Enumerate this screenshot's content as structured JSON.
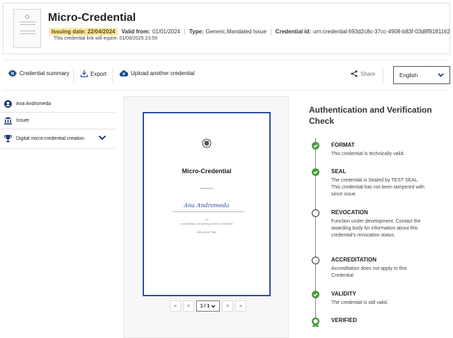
{
  "header": {
    "title": "Micro-Credential",
    "issuing_date": "Issuing date: 22/04/2024",
    "valid_from_label": "Valid from:",
    "valid_from": "01/01/2024",
    "type_label": "Type:",
    "type": "Generic,Mandated Issue",
    "credential_id_label": "Credential id:",
    "credential_id": "urn:credential:693d2c8c-37cc-4908-b83f-03d8f9181162",
    "expire": "This credential link will expire: 01/09/2025 23:59"
  },
  "toolbar": {
    "summary": "Credential summary",
    "export": "Export",
    "upload": "Upload another credential",
    "share": "Share",
    "language": "English"
  },
  "sidebar": {
    "items": [
      {
        "label": "Ana Andromeda",
        "icon": "user-icon"
      },
      {
        "label": "Issuer",
        "icon": "institution-icon"
      },
      {
        "label": "Digital micro-credential creation",
        "icon": "trophy-icon"
      }
    ]
  },
  "preview": {
    "doc_title": "Micro-Credential",
    "awarded_to": "awarded to",
    "name": "Ana Andromeda",
    "for": "for",
    "completing": "successfully completing a micro-credential",
    "grade": "with grade Pass",
    "pager": {
      "first": "«",
      "prev": "<",
      "page": "1 / 1",
      "next": ">",
      "last": "»"
    }
  },
  "verification": {
    "title": "Authentication and Verification Check",
    "steps": [
      {
        "name": "FORMAT",
        "desc": "This credential is technically valid.",
        "status": "ok"
      },
      {
        "name": "SEAL",
        "desc": "The credential is Sealed by TEST SEAL. This credential has not been tampered with since issue.",
        "status": "ok"
      },
      {
        "name": "REVOCATION",
        "desc": "Function under development. Contact the awarding body for information about this credential's revocation status.",
        "status": "pending"
      },
      {
        "name": "ACCREDITATION",
        "desc": "Accreditation does not apply to this Credential",
        "status": "pending"
      },
      {
        "name": "VALIDITY",
        "desc": "The credential is still valid.",
        "status": "ok"
      },
      {
        "name": "VERIFIED",
        "desc": "",
        "status": "verified"
      }
    ]
  },
  "colors": {
    "accent": "#2b4d9e",
    "success": "#4a9b3f",
    "highlight": "#fde8a6"
  }
}
